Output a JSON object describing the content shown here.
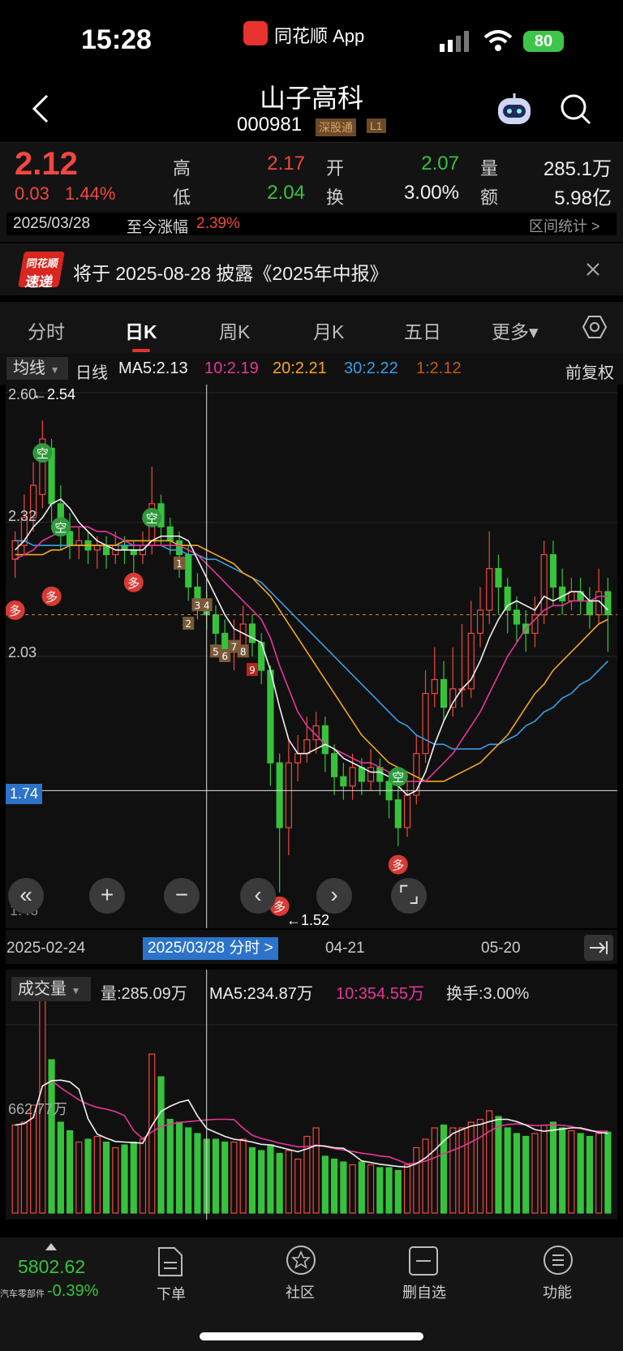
{
  "status_bar": {
    "time": "15:28",
    "app": "同花顺 App",
    "battery": "80"
  },
  "header": {
    "title": "山子高科",
    "code": "000981",
    "tag_a": "深股通",
    "tag_b": "L1"
  },
  "quote": {
    "price": "2.12",
    "change": "0.03",
    "change_pct": "1.44%",
    "high_label": "高",
    "high": "2.17",
    "low_label": "低",
    "low": "2.04",
    "open_label": "开",
    "open": "2.07",
    "turnover_label": "换",
    "turnover": "3.00%",
    "volume_label": "量",
    "volume": "285.1万",
    "amount_label": "额",
    "amount": "5.98亿",
    "date": "2025/03/28",
    "since_label": "至今涨幅",
    "since_pct": "2.39%",
    "range_stats": "区间统计 >"
  },
  "banner": {
    "logo_top": "同花顺",
    "logo_bottom": "速递",
    "text": "将于 2025-08-28 披露《2025年中报》"
  },
  "tabs": [
    {
      "label": "分时",
      "active": false
    },
    {
      "label": "日K",
      "active": true
    },
    {
      "label": "周K",
      "active": false
    },
    {
      "label": "月K",
      "active": false
    },
    {
      "label": "五日",
      "active": false
    },
    {
      "label": "更多▾",
      "active": false
    }
  ],
  "ma_row": {
    "selector": "均线",
    "period": "日线",
    "ma5": "MA5:2.13",
    "ma10": "10:2.19",
    "ma20": "20:2.21",
    "ma30": "30:2.22",
    "ma_x": "1:2.12",
    "adjust": "前复权"
  },
  "kline": {
    "y_labels": [
      "2.60",
      "2.32",
      "2.03",
      "1.74",
      "1.46"
    ],
    "max_label": "2.54",
    "min_label": "1.52",
    "cursor_price": "1.74",
    "x_labels": [
      "2025-02-24",
      "04-21",
      "05-20"
    ],
    "cursor_date": "2025/03/28 分时 >",
    "signals": [
      "多",
      "空"
    ],
    "seq": [
      "1",
      "2",
      "3",
      "4",
      "5",
      "6",
      "7",
      "8",
      "9"
    ]
  },
  "volume": {
    "selector": "成交量",
    "vol": "量:285.09万",
    "ma5": "MA5:234.87万",
    "ma10": "10:354.55万",
    "turn": "换手:3.00%",
    "y_label": "662.77万"
  },
  "bottom": {
    "index_value": "5802.62",
    "index_name": "汽车零部件",
    "index_pct": "-0.39%",
    "nav": [
      {
        "label": "下单"
      },
      {
        "label": "社区"
      },
      {
        "label": "删自选"
      },
      {
        "label": "功能"
      }
    ]
  },
  "colors": {
    "up": "#f2483f",
    "down": "#36c33c",
    "ma5": "#f0f0f0",
    "ma10": "#e6369a",
    "ma20": "#f5a623",
    "ma30": "#3a9ee4"
  },
  "chart_data": {
    "type": "candlestick",
    "ylim": [
      1.46,
      2.6
    ],
    "candles": [
      [
        2.24,
        2.28,
        2.3,
        2.2
      ],
      [
        2.27,
        2.33,
        2.38,
        2.25
      ],
      [
        2.33,
        2.4,
        2.45,
        2.3
      ],
      [
        2.38,
        2.5,
        2.54,
        2.35
      ],
      [
        2.48,
        2.36,
        2.5,
        2.32
      ],
      [
        2.36,
        2.3,
        2.4,
        2.26
      ],
      [
        2.3,
        2.27,
        2.34,
        2.24
      ],
      [
        2.27,
        2.28,
        2.31,
        2.24
      ],
      [
        2.28,
        2.26,
        2.3,
        2.23
      ],
      [
        2.26,
        2.27,
        2.29,
        2.22
      ],
      [
        2.27,
        2.25,
        2.29,
        2.22
      ],
      [
        2.25,
        2.27,
        2.3,
        2.23
      ],
      [
        2.27,
        2.26,
        2.29,
        2.23
      ],
      [
        2.26,
        2.25,
        2.28,
        2.21
      ],
      [
        2.25,
        2.27,
        2.3,
        2.23
      ],
      [
        2.27,
        2.36,
        2.44,
        2.25
      ],
      [
        2.36,
        2.31,
        2.38,
        2.27
      ],
      [
        2.31,
        2.28,
        2.33,
        2.25
      ],
      [
        2.28,
        2.25,
        2.3,
        2.2
      ],
      [
        2.25,
        2.18,
        2.27,
        2.15
      ],
      [
        2.18,
        2.14,
        2.21,
        2.11
      ],
      [
        2.14,
        2.12,
        2.17,
        2.09
      ],
      [
        2.12,
        2.08,
        2.14,
        2.05
      ],
      [
        2.08,
        2.04,
        2.11,
        2.02
      ],
      [
        2.04,
        2.05,
        2.11,
        2.0
      ],
      [
        2.05,
        2.1,
        2.14,
        2.03
      ],
      [
        2.1,
        2.06,
        2.12,
        2.03
      ],
      [
        2.06,
        2.0,
        2.08,
        1.97
      ],
      [
        2.0,
        1.8,
        2.01,
        1.75
      ],
      [
        1.8,
        1.66,
        1.82,
        1.52
      ],
      [
        1.66,
        1.8,
        1.85,
        1.6
      ],
      [
        1.8,
        1.82,
        1.86,
        1.76
      ],
      [
        1.82,
        1.85,
        1.9,
        1.8
      ],
      [
        1.85,
        1.88,
        1.91,
        1.82
      ],
      [
        1.88,
        1.82,
        1.9,
        1.78
      ],
      [
        1.82,
        1.77,
        1.84,
        1.73
      ],
      [
        1.77,
        1.75,
        1.8,
        1.72
      ],
      [
        1.75,
        1.79,
        1.82,
        1.72
      ],
      [
        1.79,
        1.76,
        1.81,
        1.73
      ],
      [
        1.76,
        1.79,
        1.83,
        1.74
      ],
      [
        1.79,
        1.76,
        1.81,
        1.73
      ],
      [
        1.76,
        1.72,
        1.78,
        1.68
      ],
      [
        1.72,
        1.66,
        1.75,
        1.62
      ],
      [
        1.66,
        1.73,
        1.76,
        1.64
      ],
      [
        1.73,
        1.82,
        1.86,
        1.71
      ],
      [
        1.82,
        1.95,
        2.0,
        1.8
      ],
      [
        1.95,
        1.98,
        2.05,
        1.92
      ],
      [
        1.98,
        1.92,
        2.02,
        1.89
      ],
      [
        1.92,
        1.96,
        2.05,
        1.9
      ],
      [
        1.96,
        1.96,
        2.1,
        1.92
      ],
      [
        1.96,
        2.08,
        2.15,
        1.94
      ],
      [
        2.08,
        2.13,
        2.18,
        2.05
      ],
      [
        2.13,
        2.22,
        2.3,
        2.1
      ],
      [
        2.22,
        2.18,
        2.25,
        2.12
      ],
      [
        2.18,
        2.13,
        2.2,
        2.08
      ],
      [
        2.13,
        2.1,
        2.16,
        2.06
      ],
      [
        2.1,
        2.08,
        2.13,
        2.04
      ],
      [
        2.08,
        2.12,
        2.16,
        2.05
      ],
      [
        2.12,
        2.25,
        2.28,
        2.1
      ],
      [
        2.25,
        2.18,
        2.28,
        2.14
      ],
      [
        2.18,
        2.15,
        2.22,
        2.12
      ],
      [
        2.15,
        2.17,
        2.2,
        2.13
      ],
      [
        2.17,
        2.15,
        2.2,
        2.12
      ],
      [
        2.15,
        2.12,
        2.18,
        2.09
      ],
      [
        2.12,
        2.17,
        2.22,
        2.1
      ],
      [
        2.17,
        2.12,
        2.2,
        2.04
      ]
    ],
    "ma5": [
      2.26,
      2.28,
      2.31,
      2.33,
      2.36,
      2.37,
      2.35,
      2.32,
      2.3,
      2.28,
      2.27,
      2.26,
      2.26,
      2.26,
      2.26,
      2.28,
      2.29,
      2.29,
      2.29,
      2.28,
      2.24,
      2.2,
      2.16,
      2.12,
      2.09,
      2.08,
      2.07,
      2.06,
      2.0,
      1.92,
      1.85,
      1.82,
      1.82,
      1.83,
      1.84,
      1.83,
      1.81,
      1.8,
      1.79,
      1.78,
      1.78,
      1.77,
      1.75,
      1.73,
      1.74,
      1.78,
      1.84,
      1.89,
      1.93,
      1.96,
      1.98,
      2.02,
      2.07,
      2.11,
      2.14,
      2.15,
      2.14,
      2.13,
      2.16,
      2.15,
      2.16,
      2.17,
      2.17,
      2.15,
      2.15,
      2.13
    ],
    "ma10": [
      2.24,
      2.25,
      2.26,
      2.28,
      2.29,
      2.3,
      2.31,
      2.31,
      2.31,
      2.3,
      2.3,
      2.29,
      2.28,
      2.27,
      2.27,
      2.27,
      2.27,
      2.27,
      2.27,
      2.26,
      2.25,
      2.23,
      2.21,
      2.19,
      2.17,
      2.15,
      2.13,
      2.11,
      2.07,
      2.01,
      1.96,
      1.91,
      1.88,
      1.86,
      1.84,
      1.83,
      1.82,
      1.81,
      1.8,
      1.8,
      1.79,
      1.78,
      1.77,
      1.76,
      1.76,
      1.76,
      1.78,
      1.8,
      1.82,
      1.85,
      1.88,
      1.91,
      1.95,
      1.99,
      2.03,
      2.06,
      2.09,
      2.11,
      2.13,
      2.14,
      2.14,
      2.15,
      2.15,
      2.15,
      2.16,
      2.16
    ],
    "ma20": [
      2.25,
      2.25,
      2.25,
      2.25,
      2.26,
      2.26,
      2.27,
      2.27,
      2.27,
      2.27,
      2.27,
      2.27,
      2.28,
      2.28,
      2.28,
      2.28,
      2.28,
      2.28,
      2.27,
      2.27,
      2.27,
      2.26,
      2.25,
      2.24,
      2.23,
      2.21,
      2.2,
      2.18,
      2.16,
      2.13,
      2.1,
      2.07,
      2.04,
      2.01,
      1.98,
      1.95,
      1.92,
      1.89,
      1.86,
      1.84,
      1.82,
      1.8,
      1.79,
      1.78,
      1.77,
      1.76,
      1.76,
      1.76,
      1.77,
      1.78,
      1.79,
      1.8,
      1.82,
      1.84,
      1.86,
      1.89,
      1.92,
      1.95,
      1.97,
      2.0,
      2.02,
      2.04,
      2.06,
      2.08,
      2.1,
      2.11
    ],
    "ma30": [
      2.28,
      2.28,
      2.27,
      2.27,
      2.27,
      2.27,
      2.27,
      2.27,
      2.27,
      2.27,
      2.27,
      2.27,
      2.27,
      2.27,
      2.27,
      2.27,
      2.27,
      2.26,
      2.26,
      2.25,
      2.25,
      2.24,
      2.24,
      2.23,
      2.22,
      2.21,
      2.2,
      2.19,
      2.17,
      2.15,
      2.13,
      2.11,
      2.09,
      2.07,
      2.05,
      2.03,
      2.01,
      1.99,
      1.97,
      1.95,
      1.93,
      1.91,
      1.89,
      1.88,
      1.86,
      1.85,
      1.84,
      1.84,
      1.83,
      1.83,
      1.83,
      1.83,
      1.84,
      1.84,
      1.85,
      1.86,
      1.88,
      1.89,
      1.91,
      1.92,
      1.94,
      1.95,
      1.97,
      1.98,
      2.0,
      2.02
    ],
    "volumes": [
      310,
      320,
      380,
      780,
      540,
      320,
      290,
      250,
      260,
      270,
      250,
      230,
      240,
      250,
      260,
      560,
      480,
      330,
      320,
      300,
      280,
      260,
      260,
      250,
      250,
      260,
      230,
      220,
      240,
      210,
      220,
      190,
      270,
      300,
      200,
      190,
      180,
      170,
      180,
      170,
      160,
      160,
      150,
      170,
      230,
      260,
      300,
      310,
      300,
      300,
      320,
      330,
      360,
      340,
      300,
      280,
      270,
      280,
      310,
      320,
      300,
      290,
      280,
      270,
      280,
      285
    ]
  }
}
